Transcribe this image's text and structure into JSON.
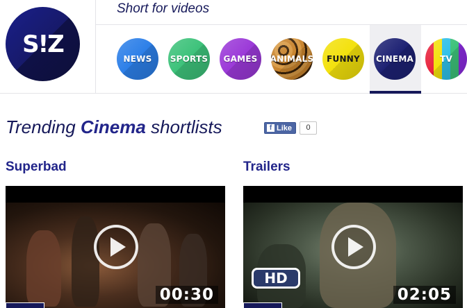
{
  "header": {
    "logo_text": "S!Z",
    "tagline": "Short for videos",
    "categories": [
      {
        "label": "NEWS",
        "color": "#2c7fe8"
      },
      {
        "label": "SPORTS",
        "color": "#3dc27a"
      },
      {
        "label": "GAMES",
        "color": "#9b39d8"
      },
      {
        "label": "ANIMALS",
        "color": "#c8832c"
      },
      {
        "label": "FUNNY",
        "color": "#f3e10c"
      },
      {
        "label": "CINEMA",
        "color": "#1d2173",
        "selected": true
      },
      {
        "label": "TV",
        "color": "#e8223c"
      }
    ]
  },
  "trending": {
    "prefix": "Trending",
    "highlight": "Cinema",
    "suffix": "shortlists",
    "like_label": "Like",
    "like_count": "0"
  },
  "videos": [
    {
      "title": "Superbad",
      "duration": "00:30",
      "hd": false
    },
    {
      "title": "Trailers",
      "duration": "02:05",
      "hd": true,
      "hd_label": "HD"
    }
  ],
  "colors": {
    "brand_navy": "#16195a",
    "accent_blue": "#22258a",
    "facebook": "#4c66a4"
  }
}
